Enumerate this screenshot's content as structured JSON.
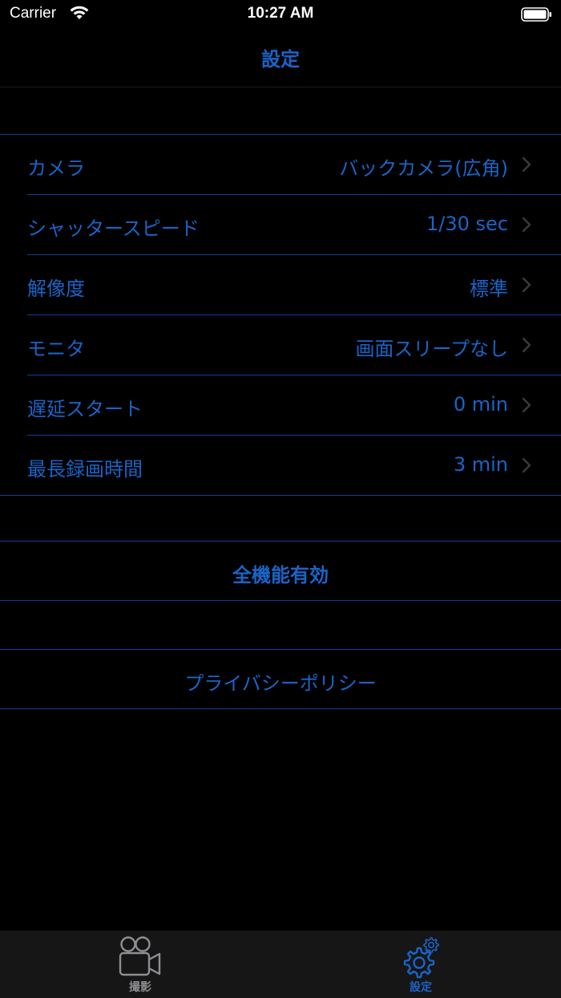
{
  "status_bar": {
    "carrier": "Carrier",
    "time": "10:27 AM"
  },
  "nav": {
    "title": "設定"
  },
  "settings": [
    {
      "label": "カメラ",
      "value": "バックカメラ(広角)"
    },
    {
      "label": "シャッタースピード",
      "value": "1/30 sec"
    },
    {
      "label": "解像度",
      "value": "標準"
    },
    {
      "label": "モニタ",
      "value": "画面スリープなし"
    },
    {
      "label": "遅延スタート",
      "value": "0 min"
    },
    {
      "label": "最長録画時間",
      "value": "3 min"
    }
  ],
  "actions": {
    "unlock_all": "全機能有効",
    "privacy_policy": "プライバシーポリシー"
  },
  "tab_bar": {
    "tabs": [
      {
        "label": "撮影",
        "icon": "video-camera-icon",
        "selected": false
      },
      {
        "label": "設定",
        "icon": "gear-icon",
        "selected": true
      }
    ]
  },
  "colors": {
    "accent": "#1a64c8",
    "separator": "#0e3f9a",
    "background": "#000000",
    "tab_bar_bg": "#161616",
    "tab_inactive": "#8e8e93"
  }
}
